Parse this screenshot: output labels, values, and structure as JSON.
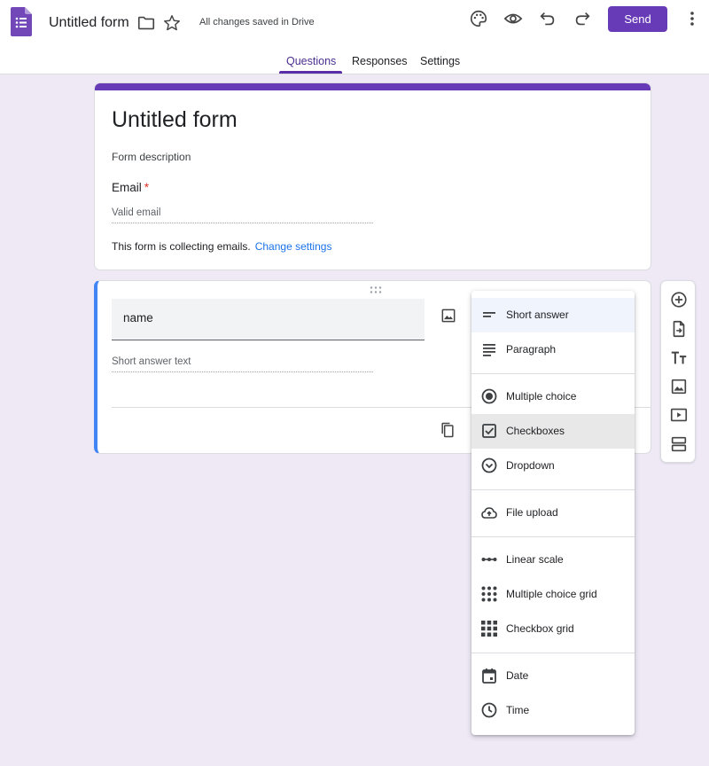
{
  "header": {
    "title": "Untitled form",
    "save_status": "All changes saved in Drive",
    "send_label": "Send"
  },
  "tabs": [
    {
      "label": "Questions",
      "active": true
    },
    {
      "label": "Responses",
      "active": false
    },
    {
      "label": "Settings",
      "active": false
    }
  ],
  "form": {
    "title": "Untitled form",
    "description_placeholder": "Form description",
    "email_label": "Email",
    "required_mark": "*",
    "email_placeholder": "Valid email",
    "collecting_note": "This form is collecting emails.",
    "change_settings_link": "Change settings"
  },
  "question": {
    "title_value": "name",
    "answer_placeholder": "Short answer text"
  },
  "question_type_menu": {
    "items": [
      {
        "label": "Short answer",
        "icon": "short-answer-icon",
        "state": "selected"
      },
      {
        "label": "Paragraph",
        "icon": "paragraph-icon"
      },
      {
        "label": "Multiple choice",
        "icon": "radio-button-icon"
      },
      {
        "label": "Checkboxes",
        "icon": "checkbox-icon",
        "state": "hovered"
      },
      {
        "label": "Dropdown",
        "icon": "dropdown-circle-icon"
      },
      {
        "label": "File upload",
        "icon": "cloud-upload-icon"
      },
      {
        "label": "Linear scale",
        "icon": "linear-scale-icon"
      },
      {
        "label": "Multiple choice grid",
        "icon": "dot-grid-icon"
      },
      {
        "label": "Checkbox grid",
        "icon": "square-grid-icon"
      },
      {
        "label": "Date",
        "icon": "calendar-icon"
      },
      {
        "label": "Time",
        "icon": "clock-icon"
      }
    ]
  },
  "side_toolbar": [
    "add-question-icon",
    "import-questions-icon",
    "add-title-icon",
    "add-image-icon",
    "add-video-icon",
    "add-section-icon"
  ],
  "colors": {
    "brand": "#673ab7",
    "background": "#efe9f6",
    "link": "#1a73e8",
    "active_question_border": "#4285f4",
    "required": "#d93025"
  }
}
